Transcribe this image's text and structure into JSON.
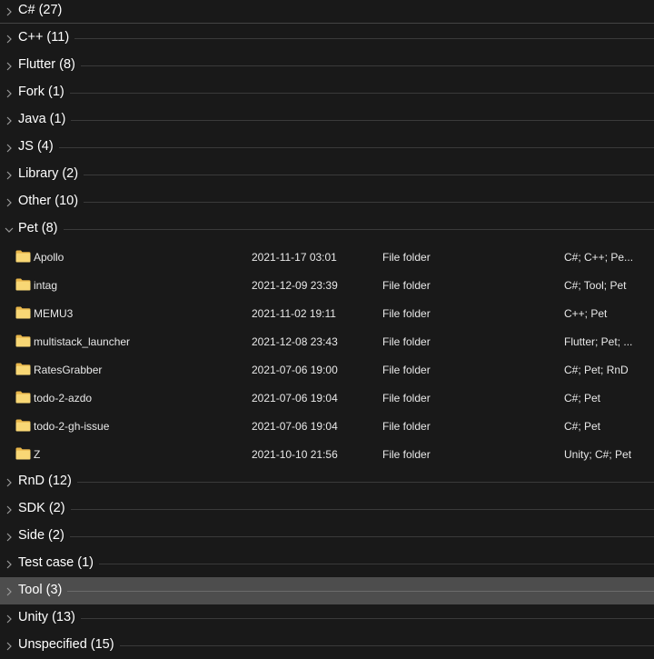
{
  "groups": [
    {
      "label": "C# (27)",
      "expanded": false,
      "selected": false
    },
    {
      "label": "C++ (11)",
      "expanded": false,
      "selected": false
    },
    {
      "label": "Flutter (8)",
      "expanded": false,
      "selected": false
    },
    {
      "label": "Fork (1)",
      "expanded": false,
      "selected": false
    },
    {
      "label": "Java (1)",
      "expanded": false,
      "selected": false
    },
    {
      "label": "JS (4)",
      "expanded": false,
      "selected": false
    },
    {
      "label": "Library (2)",
      "expanded": false,
      "selected": false
    },
    {
      "label": "Other (10)",
      "expanded": false,
      "selected": false
    },
    {
      "label": "Pet (8)",
      "expanded": true,
      "selected": false,
      "items": [
        {
          "name": "Apollo",
          "date": "2021-11-17 03:01",
          "type": "File folder",
          "tags": "C#; C++; Pe..."
        },
        {
          "name": "intag",
          "date": "2021-12-09 23:39",
          "type": "File folder",
          "tags": "C#; Tool; Pet"
        },
        {
          "name": "MEMU3",
          "date": "2021-11-02 19:11",
          "type": "File folder",
          "tags": "C++; Pet"
        },
        {
          "name": "multistack_launcher",
          "date": "2021-12-08 23:43",
          "type": "File folder",
          "tags": "Flutter; Pet; ..."
        },
        {
          "name": "RatesGrabber",
          "date": "2021-07-06 19:00",
          "type": "File folder",
          "tags": "C#; Pet; RnD"
        },
        {
          "name": "todo-2-azdo",
          "date": "2021-07-06 19:04",
          "type": "File folder",
          "tags": "C#; Pet"
        },
        {
          "name": "todo-2-gh-issue",
          "date": "2021-07-06 19:04",
          "type": "File folder",
          "tags": "C#; Pet"
        },
        {
          "name": "Z",
          "date": "2021-10-10 21:56",
          "type": "File folder",
          "tags": "Unity; C#; Pet"
        }
      ]
    },
    {
      "label": "RnD (12)",
      "expanded": false,
      "selected": false
    },
    {
      "label": "SDK (2)",
      "expanded": false,
      "selected": false
    },
    {
      "label": "Side (2)",
      "expanded": false,
      "selected": false
    },
    {
      "label": "Test case (1)",
      "expanded": false,
      "selected": false
    },
    {
      "label": "Tool (3)",
      "expanded": false,
      "selected": true
    },
    {
      "label": "Unity (13)",
      "expanded": false,
      "selected": false
    },
    {
      "label": "Unspecified (15)",
      "expanded": false,
      "selected": false
    }
  ],
  "icons": {
    "collapsed": "chevron-right-icon",
    "expanded": "chevron-down-icon",
    "folder": "folder-icon"
  },
  "colors": {
    "background": "#191919",
    "selected": "#4d4d4d",
    "folder": "#f8d775",
    "text": "#ffffff"
  }
}
